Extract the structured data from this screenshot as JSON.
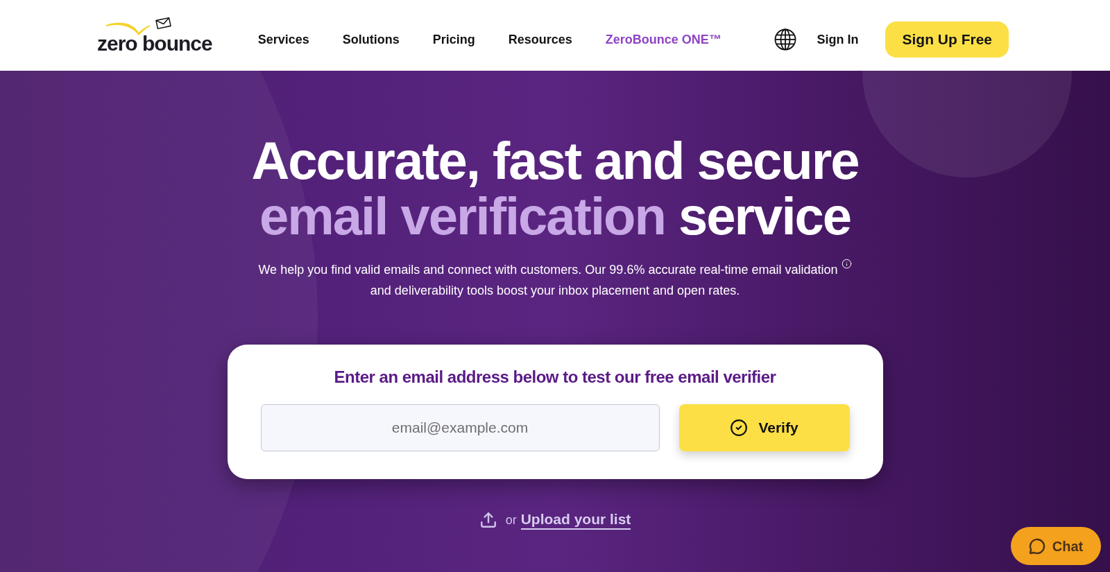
{
  "header": {
    "logo": "zero bounce",
    "nav": [
      {
        "label": "Services",
        "highlighted": false
      },
      {
        "label": "Solutions",
        "highlighted": false
      },
      {
        "label": "Pricing",
        "highlighted": false
      },
      {
        "label": "Resources",
        "highlighted": false
      },
      {
        "label": "ZeroBounce ONE™",
        "highlighted": true
      }
    ],
    "sign_in": "Sign In",
    "sign_up": "Sign Up Free"
  },
  "hero": {
    "headline": "Accurate, fast and secure",
    "headline_accent": "email verification",
    "headline_end": "service",
    "subtitle_parts": [
      "We help you find valid emails and connect with customers. Our 99.6% accurate real-time email validation",
      "and deliverability tools boost your inbox placement and open rates."
    ]
  },
  "verifier": {
    "title": "Enter an email address below to test our free email verifier",
    "email_field": {
      "placeholder": "email@example.com"
    },
    "verify_button": "Verify"
  },
  "upload": {
    "prefix": "or",
    "link": "Upload your list"
  },
  "chat_button": "Chat"
}
